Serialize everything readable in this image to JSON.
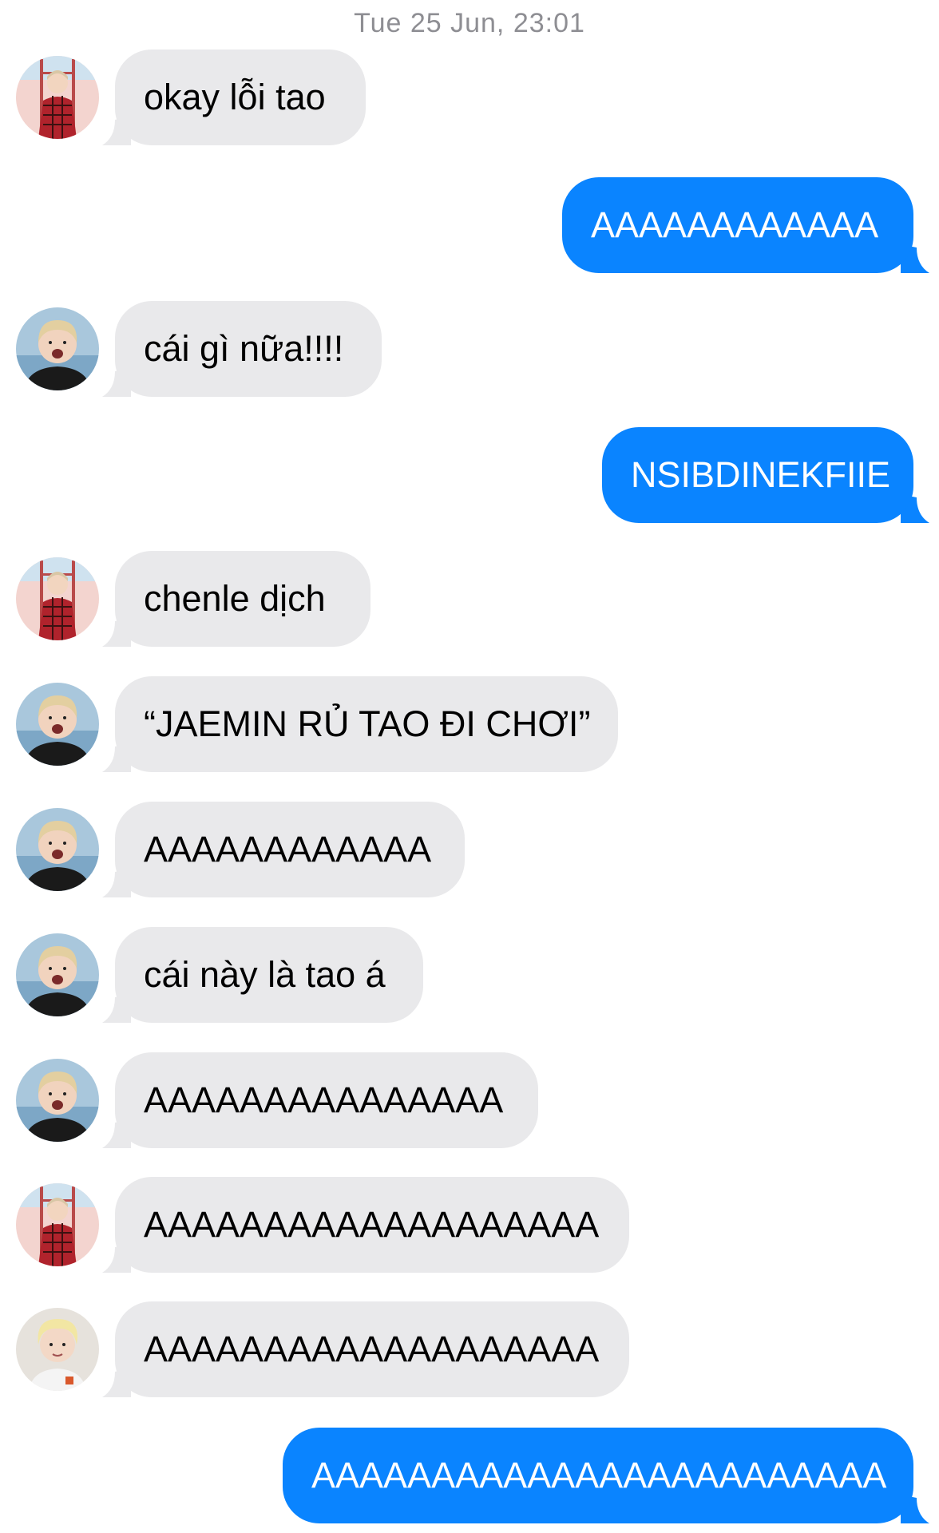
{
  "conversation": {
    "timestamp": "Tue 25 Jun, 23:01",
    "colors": {
      "incoming_bubble": "#e9e9eb",
      "outgoing_bubble": "#0a84ff",
      "incoming_text": "#000000",
      "outgoing_text": "#ffffff",
      "timestamp_text": "#8e8e93"
    },
    "messages": [
      {
        "direction": "incoming",
        "sender_avatar": "avatar-red-plaid-jacket",
        "text": "okay lỗi tao"
      },
      {
        "direction": "outgoing",
        "text": "AAAAAAAAAAAA"
      },
      {
        "direction": "incoming",
        "sender_avatar": "avatar-black-hoodie",
        "text": "cái gì nữa!!!!"
      },
      {
        "direction": "outgoing",
        "text": "NSIBDINEKFIIE"
      },
      {
        "direction": "incoming",
        "sender_avatar": "avatar-red-plaid-jacket",
        "text": "chenle dịch"
      },
      {
        "direction": "incoming",
        "sender_avatar": "avatar-black-hoodie",
        "text": "“JAEMIN RỦ TAO ĐI CHƠI”"
      },
      {
        "direction": "incoming",
        "sender_avatar": "avatar-black-hoodie",
        "text": "AAAAAAAAAAAA"
      },
      {
        "direction": "incoming",
        "sender_avatar": "avatar-black-hoodie",
        "text": "cái này là tao á"
      },
      {
        "direction": "incoming",
        "sender_avatar": "avatar-black-hoodie",
        "text": "AAAAAAAAAAAAAAA"
      },
      {
        "direction": "incoming",
        "sender_avatar": "avatar-red-plaid-jacket",
        "text": "AAAAAAAAAAAAAAAAAAA"
      },
      {
        "direction": "incoming",
        "sender_avatar": "avatar-blond-hair",
        "text": "AAAAAAAAAAAAAAAAAAA"
      },
      {
        "direction": "outgoing",
        "text": "AAAAAAAAAAAAAAAAAAAAAAAA"
      }
    ]
  }
}
